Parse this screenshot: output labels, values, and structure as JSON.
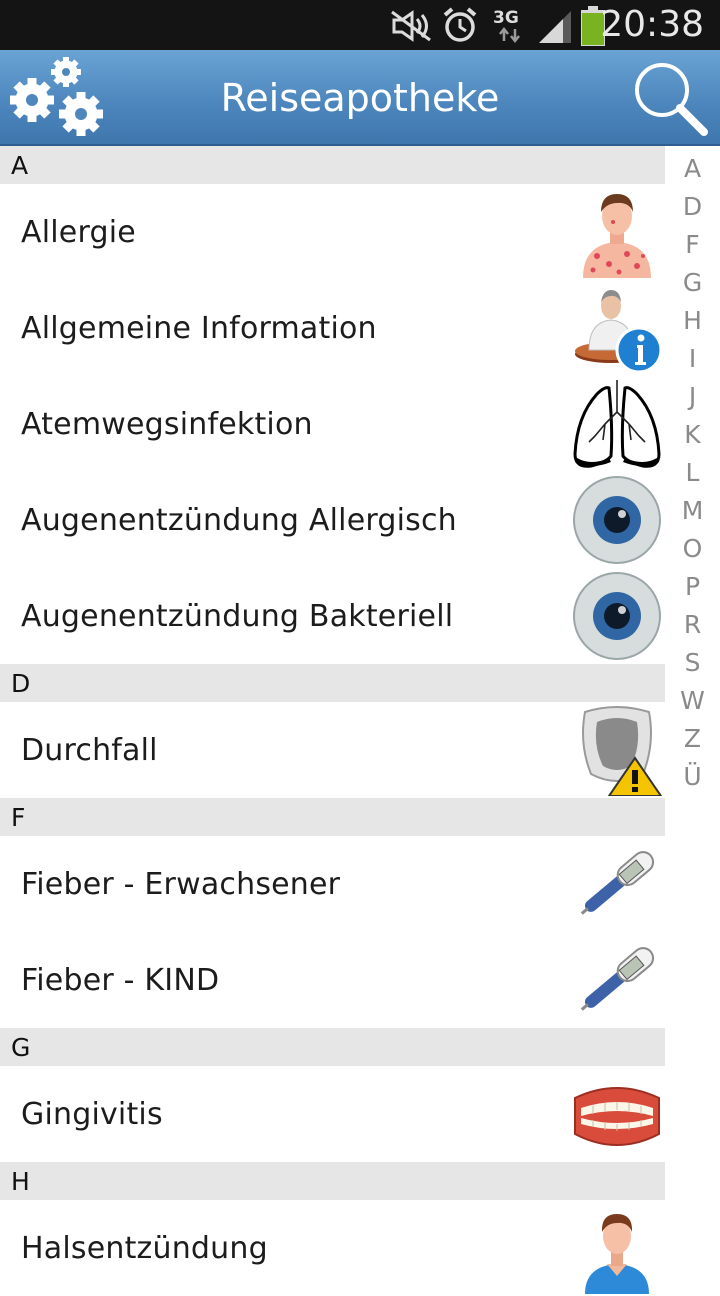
{
  "status_bar": {
    "time": "20:38",
    "network": "3G",
    "icons": [
      "mute-icon",
      "alarm-icon",
      "network-3g-icon",
      "signal-icon",
      "battery-icon"
    ]
  },
  "header": {
    "title": "Reiseapotheke",
    "settings_icon": "gears-icon",
    "search_icon": "search-icon"
  },
  "sections": [
    {
      "letter": "A",
      "items": [
        {
          "label": "Allergie",
          "icon": "allergy-person-icon"
        },
        {
          "label": "Allgemeine Information",
          "icon": "info-person-icon"
        },
        {
          "label": "Atemwegsinfektion",
          "icon": "lungs-icon"
        },
        {
          "label": "Augenentzündung Allergisch",
          "icon": "eye-icon"
        },
        {
          "label": "Augenentzündung Bakteriell",
          "icon": "eye-icon"
        }
      ]
    },
    {
      "letter": "D",
      "items": [
        {
          "label": "Durchfall",
          "icon": "toilet-warning-icon"
        }
      ]
    },
    {
      "letter": "F",
      "items": [
        {
          "label": "Fieber - Erwachsener",
          "icon": "thermometer-icon"
        },
        {
          "label": "Fieber - KIND",
          "icon": "thermometer-icon"
        }
      ]
    },
    {
      "letter": "G",
      "items": [
        {
          "label": "Gingivitis",
          "icon": "dentures-icon"
        }
      ]
    },
    {
      "letter": "H",
      "items": [
        {
          "label": "Halsentzündung",
          "icon": "person-icon"
        }
      ]
    }
  ],
  "index_letters": [
    "A",
    "D",
    "F",
    "G",
    "H",
    "I",
    "J",
    "K",
    "L",
    "M",
    "O",
    "P",
    "R",
    "S",
    "W",
    "Z",
    "Ü"
  ],
  "colors": {
    "appbar": "#4d87bd",
    "section_header": "#e6e6e6",
    "index_text": "#8a8a8a",
    "statusbar": "#141414"
  }
}
